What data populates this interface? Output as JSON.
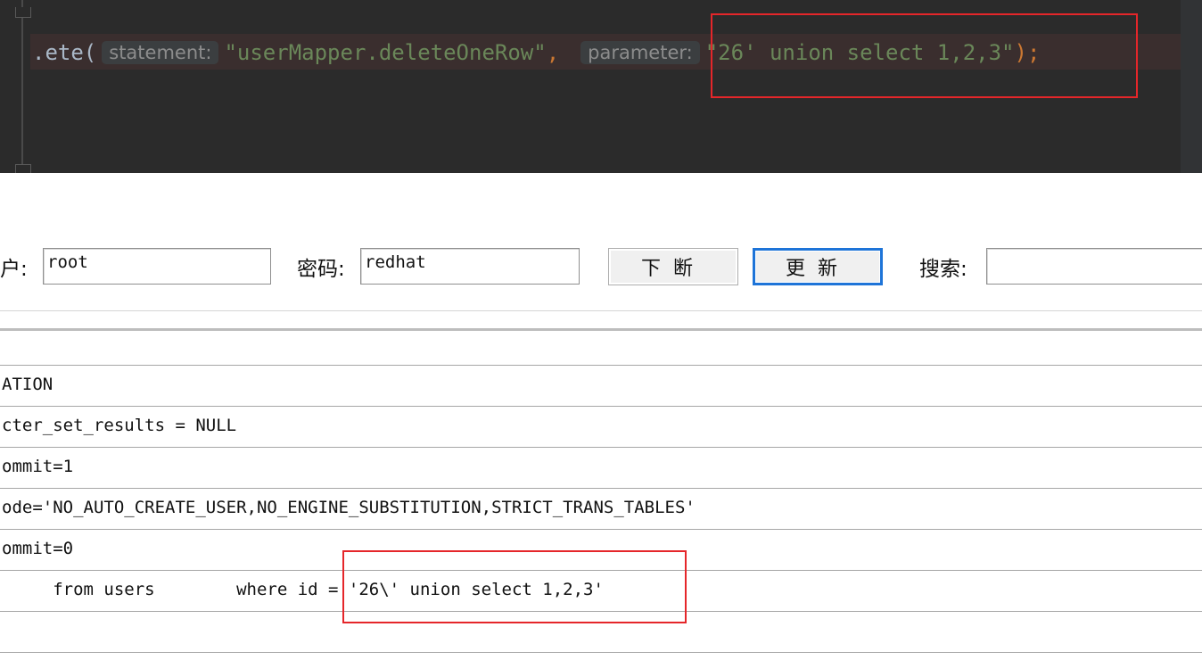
{
  "ide": {
    "code": {
      "method_fragment": ".ete(",
      "statement_hint": "statement:",
      "statement_value": "\"userMapper.deleteOneRow\"",
      "comma": ",",
      "parameter_hint": "parameter:",
      "parameter_value": "\"26' union select 1,2,3\"",
      "close": ");"
    }
  },
  "form": {
    "user_label": "户:",
    "user_value": "root",
    "password_label": "密码:",
    "password_value": "redhat",
    "disconnect_label": "下断",
    "refresh_label": "更新",
    "search_label": "搜索:",
    "search_value": ""
  },
  "log": {
    "rows": [
      "ATION",
      "cter_set_results = NULL",
      "ommit=1",
      "ode='NO_AUTO_CREATE_USER,NO_ENGINE_SUBSTITUTION,STRICT_TRANS_TABLES'",
      "ommit=0",
      "     from users        where id = '26\\' union select 1,2,3'",
      ""
    ]
  },
  "colors": {
    "annotation": "#e5262a",
    "ide_background": "#2b2b2b",
    "string": "#6a8759",
    "focus_border": "#1e74d8"
  }
}
